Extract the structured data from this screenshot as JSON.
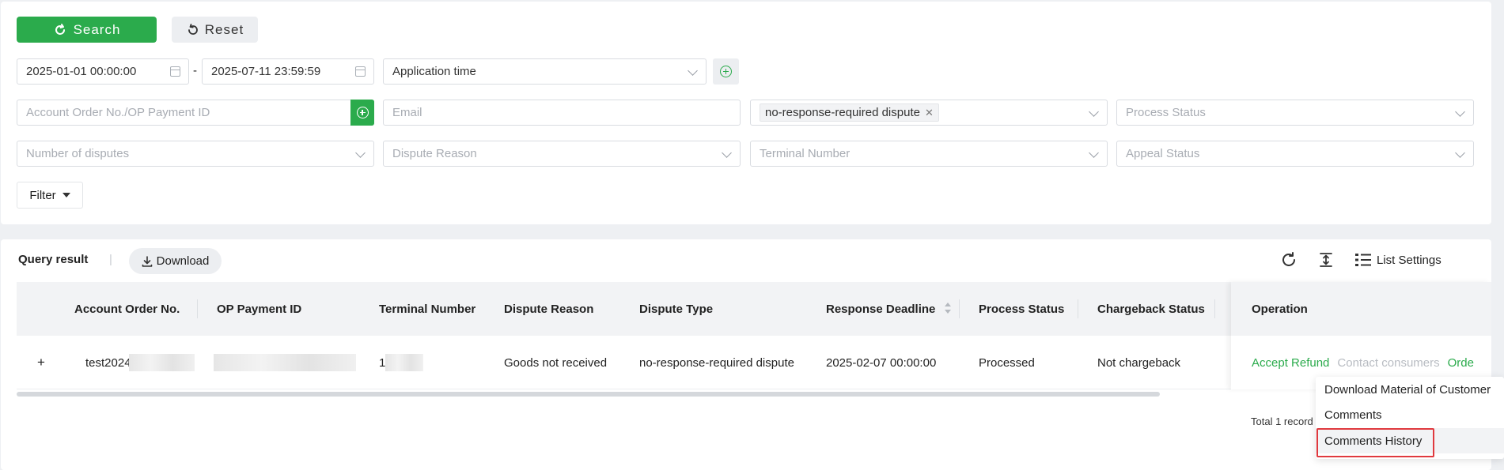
{
  "toolbar": {
    "search_label": "Search",
    "reset_label": "Reset"
  },
  "filters": {
    "start_date": "2025-01-01 00:00:00",
    "date_separator": "-",
    "end_date": "2025-07-11 23:59:59",
    "time_type": "Application time",
    "order_placeholder": "Account Order No./OP Payment ID",
    "email_placeholder": "Email",
    "dispute_type_tag": "no-response-required dispute",
    "process_status_placeholder": "Process Status",
    "disputes_count_placeholder": "Number of disputes",
    "dispute_reason_placeholder": "Dispute Reason",
    "terminal_placeholder": "Terminal Number",
    "appeal_status_placeholder": "Appeal Status",
    "filter_label": "Filter"
  },
  "result": {
    "title": "Query result",
    "divider": "|",
    "download_label": "Download",
    "list_settings_label": "List Settings",
    "total_label": "Total 1 record"
  },
  "table": {
    "columns": [
      "Account Order No.",
      "OP Payment ID",
      "Terminal Number",
      "Dispute Reason",
      "Dispute Type",
      "Response Deadline",
      "Process Status",
      "Chargeback Status",
      "Operation"
    ],
    "rows": [
      {
        "expand": "+",
        "account_order_no": "test2024",
        "terminal_number": "1",
        "dispute_reason": "Goods not received",
        "dispute_type": "no-response-required dispute",
        "response_deadline": "2025-02-07 00:00:00",
        "process_status": "Processed",
        "chargeback_status": "Not chargeback",
        "operations": [
          "Accept Refund",
          "Contact consumers",
          "Orde"
        ]
      }
    ]
  },
  "dropdown_menu": {
    "items": [
      "Download Material of Customer",
      "Comments",
      "Comments History"
    ]
  },
  "colors": {
    "accent": "#2bab4c",
    "highlight_box": "#e0393e"
  }
}
